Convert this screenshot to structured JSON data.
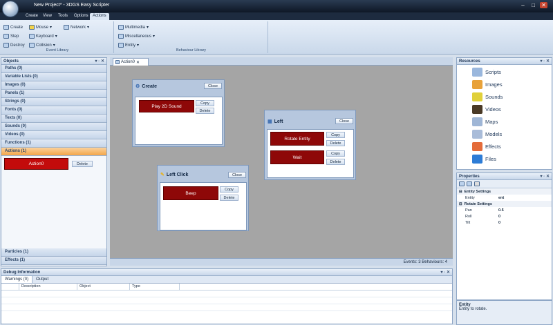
{
  "app": {
    "title": "New Project* - 3DGS Easy Scripter",
    "min": "–",
    "max": "□",
    "close": "✕"
  },
  "menu": [
    "Create",
    "View",
    "Tools",
    "Options",
    "Actions"
  ],
  "ribbon": {
    "event_library": {
      "label": "Event Library",
      "items": [
        "Create",
        "Mouse",
        "Network",
        "Step",
        "Keyboard",
        "Destroy",
        "Collision"
      ]
    },
    "behaviour_library": {
      "label": "Behaviour Library",
      "items": [
        "Multimedia",
        "Miscellaneous",
        "Entity"
      ]
    }
  },
  "objects": {
    "title": "Objects",
    "pin": "▾ ◦ ✕",
    "items": [
      "Paths (0)",
      "Variable Lists (0)",
      "Images (0)",
      "Panels (1)",
      "Strings (0)",
      "Fonts (0)",
      "Texts (0)",
      "Sounds (0)",
      "Videos (0)",
      "Functions (1)",
      "Actions (1)"
    ],
    "action_button": "Action0",
    "delete": "Delete",
    "bottom": [
      "Particles (1)",
      "Effects (1)"
    ]
  },
  "tab": {
    "label": "Action0",
    "close": "✕"
  },
  "canvas": {
    "blocks": [
      {
        "title": "Create",
        "close": "Close",
        "actions": [
          {
            "label": "Play 2D Sound",
            "copy": "Copy",
            "delete": "Delete"
          }
        ]
      },
      {
        "title": "Left",
        "close": "Close",
        "actions": [
          {
            "label": "Rotate Entity",
            "copy": "Copy",
            "delete": "Delete"
          },
          {
            "label": "Wait",
            "copy": "Copy",
            "delete": "Delete"
          }
        ]
      },
      {
        "title": "Left Click",
        "close": "Close",
        "actions": [
          {
            "label": "Beep",
            "copy": "Copy",
            "delete": "Delete"
          }
        ]
      }
    ],
    "status": "Events: 3   Behaviours: 4"
  },
  "resources": {
    "title": "Resources",
    "items": [
      "Scripts",
      "Images",
      "Sounds",
      "Videos",
      "Maps",
      "Models",
      "Effects",
      "Files"
    ],
    "colors": [
      "#9ab7dd",
      "#e8a23a",
      "#e0d03a",
      "#4a3a26",
      "#9fb6d6",
      "#a9bcd9",
      "#e46c3a",
      "#2d7cd6"
    ]
  },
  "properties": {
    "title": "Properties",
    "sections": [
      {
        "name": "Entity Settings",
        "rows": [
          {
            "k": "Entity",
            "v": "ent"
          }
        ]
      },
      {
        "name": "Rotate Settings",
        "rows": [
          {
            "k": "Pan",
            "v": "0.5"
          },
          {
            "k": "Roll",
            "v": "0"
          },
          {
            "k": "Tilt",
            "v": "0"
          }
        ]
      }
    ],
    "desc_title": "Entity",
    "desc": "Entity to rotate."
  },
  "debug": {
    "title": "Debug Information",
    "tabs": [
      "Warnings (0)",
      "Output"
    ],
    "columns": [
      "Description",
      "Object",
      "Type"
    ]
  }
}
